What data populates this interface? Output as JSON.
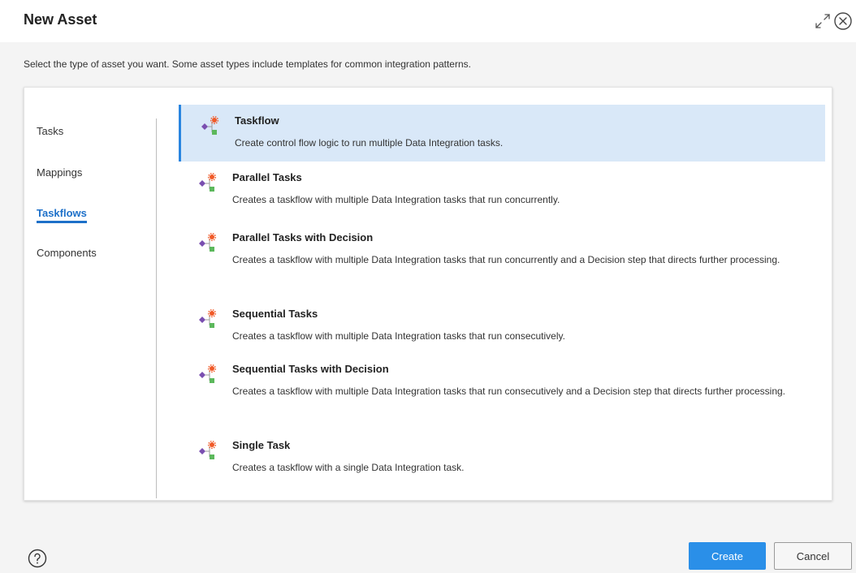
{
  "dialog": {
    "title": "New Asset",
    "intro": "Select the type of asset you want. Some asset types include templates for common integration patterns."
  },
  "nav": {
    "items": [
      {
        "label": "Tasks",
        "active": false
      },
      {
        "label": "Mappings",
        "active": false
      },
      {
        "label": "Taskflows",
        "active": true
      },
      {
        "label": "Components",
        "active": false
      }
    ]
  },
  "options": [
    {
      "title": "Taskflow",
      "description": "Create control flow logic to run multiple Data Integration tasks.",
      "selected": true
    },
    {
      "title": "Parallel Tasks",
      "description": "Creates a taskflow with multiple Data Integration tasks that run concurrently.",
      "selected": false
    },
    {
      "title": "Parallel Tasks with Decision",
      "description": "Creates a taskflow with multiple Data Integration tasks that run concurrently and a Decision step that directs further processing.",
      "selected": false
    },
    {
      "title": "Sequential Tasks",
      "description": "Creates a taskflow with multiple Data Integration tasks that run consecutively.",
      "selected": false
    },
    {
      "title": "Sequential Tasks with Decision",
      "description": "Creates a taskflow with multiple Data Integration tasks that run consecutively and a Decision step that directs further processing.",
      "selected": false
    },
    {
      "title": "Single Task",
      "description": "Creates a taskflow with a single Data Integration task.",
      "selected": false
    }
  ],
  "footer": {
    "create_label": "Create",
    "cancel_label": "Cancel"
  },
  "icons": {
    "header": [
      "expand-icon",
      "close-icon"
    ],
    "option": "taskflow-icon",
    "footer": "help-icon"
  },
  "colors": {
    "accent": "#2a8fe8",
    "nav_active": "#1d70c9",
    "selected_bg": "#d9e8f8",
    "icon_diamond": "#7a4fb0",
    "icon_gear": "#f05a28",
    "icon_square": "#5cb85c"
  }
}
